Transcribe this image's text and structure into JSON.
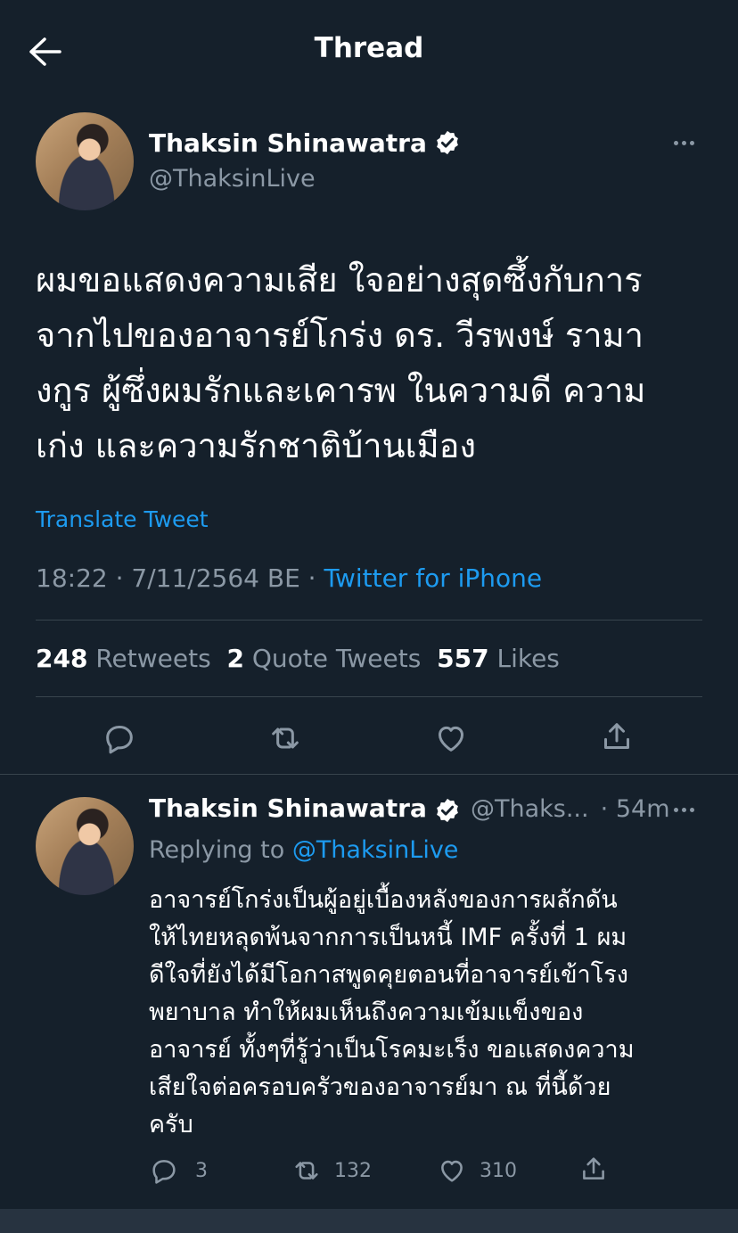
{
  "header": {
    "title": "Thread"
  },
  "colors": {
    "background": "#15202b",
    "accent": "#1d9bf0",
    "muted": "#8b98a5",
    "divider": "#38444d"
  },
  "main_tweet": {
    "author_name": "Thaksin Shinawatra",
    "handle": "@ThaksinLive",
    "text_lines": [
      "ผมขอแสดงความเสีย ใจอย่างสุดซึ้งกับการ",
      "จากไปของอาจารย์โกร่ง ดร. วีรพงษ์ รามา",
      "งกูร ผู้ซึ่งผมรักและเคารพ ในความดี ความ",
      "เก่ง และความรักชาติบ้านเมือง"
    ],
    "translate_label": "Translate Tweet",
    "timestamp": "18:22 · 7/11/2564 BE · ",
    "source": "Twitter for iPhone",
    "retweets_count": "248",
    "retweets_label": "Retweets",
    "quotes_count": "2",
    "quotes_label": "Quote Tweets",
    "likes_count": "557",
    "likes_label": "Likes"
  },
  "reply_tweet": {
    "author_name": "Thaksin Shinawatra",
    "handle": "@Thaks...",
    "time": "· 54m",
    "replying_label": "Replying to ",
    "replying_handle": "@ThaksinLive",
    "text_lines": [
      "อาจารย์โกร่งเป็นผู้อยู่เบื้องหลังของการผลักดัน",
      "ให้ไทยหลุดพ้นจากการเป็นหนี้ IMF ครั้งที่ 1  ผม",
      "ดีใจที่ยังได้มีโอกาสพูดคุยตอนที่อาจารย์เข้าโรง",
      "พยาบาล ทำให้ผมเห็นถึงความเข้มแข็งของ",
      "อาจารย์ ทั้งๆที่รู้ว่าเป็นโรคมะเร็ง ขอแสดงความ",
      "เสียใจต่อครอบครัวของอาจารย์มา ณ ที่นี้ด้วย",
      "ครับ"
    ],
    "reply_count": "3",
    "retweet_count": "132",
    "like_count": "310"
  }
}
